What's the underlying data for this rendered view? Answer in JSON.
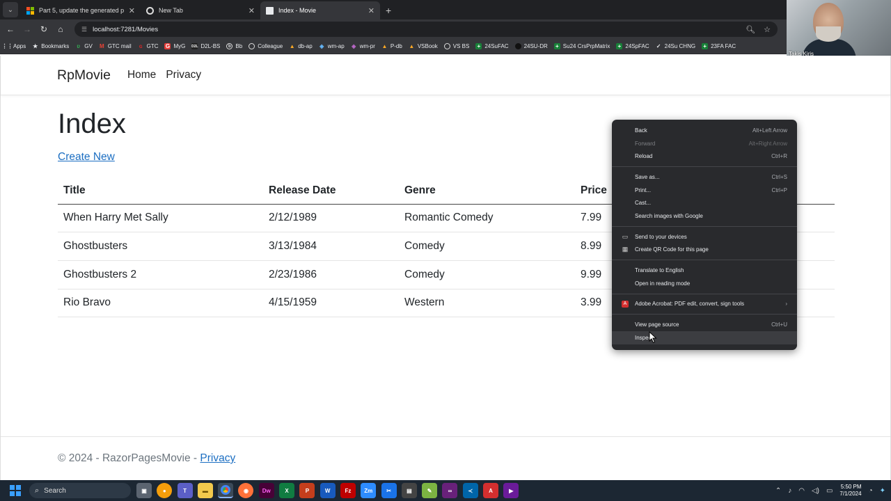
{
  "browser": {
    "tabs": [
      {
        "title": "Part 5, update the generated p",
        "active": false
      },
      {
        "title": "New Tab",
        "active": false
      },
      {
        "title": "Index - Movie",
        "active": true
      }
    ],
    "url": "localhost:7281/Movies",
    "bookmarks": [
      "Apps",
      "Bookmarks",
      "GV",
      "GTC mail",
      "GTC",
      "MyG",
      "D2L-BS",
      "Bb",
      "Colleague",
      "db-ap",
      "wm-ap",
      "wm-pr",
      "P-db",
      "VSBook",
      "VS BS",
      "24SuFAC",
      "24SU-DR",
      "Su24 CrsPrpMatrix",
      "24SpFAC",
      "24Su CHNG",
      "23FA FAC"
    ]
  },
  "webcam": {
    "name": "Takis Kiris"
  },
  "site": {
    "brand": "RpMovie",
    "nav": [
      "Home",
      "Privacy"
    ],
    "heading": "Index",
    "create_link": "Create New",
    "columns": [
      "Title",
      "Release Date",
      "Genre",
      "Price"
    ],
    "rows": [
      [
        "When Harry Met Sally",
        "2/12/1989",
        "Romantic Comedy",
        "7.99"
      ],
      [
        "Ghostbusters",
        "3/13/1984",
        "Comedy",
        "8.99"
      ],
      [
        "Ghostbusters 2",
        "2/23/1986",
        "Comedy",
        "9.99"
      ],
      [
        "Rio Bravo",
        "4/15/1959",
        "Western",
        "3.99"
      ]
    ],
    "footer": {
      "text": "© 2024 - RazorPagesMovie - ",
      "link": "Privacy"
    }
  },
  "context_menu": {
    "groups": [
      [
        {
          "label": "Back",
          "shortcut": "Alt+Left Arrow"
        },
        {
          "label": "Forward",
          "shortcut": "Alt+Right Arrow",
          "disabled": true
        },
        {
          "label": "Reload",
          "shortcut": "Ctrl+R"
        }
      ],
      [
        {
          "label": "Save as...",
          "shortcut": "Ctrl+S"
        },
        {
          "label": "Print...",
          "shortcut": "Ctrl+P"
        },
        {
          "label": "Cast...",
          "shortcut": ""
        },
        {
          "label": "Search images with Google",
          "shortcut": ""
        }
      ],
      [
        {
          "label": "Send to your devices",
          "shortcut": "",
          "icon": "devices-icon"
        },
        {
          "label": "Create QR Code for this page",
          "shortcut": "",
          "icon": "qr-code-icon"
        }
      ],
      [
        {
          "label": "Translate to English",
          "shortcut": ""
        },
        {
          "label": "Open in reading mode",
          "shortcut": ""
        }
      ],
      [
        {
          "label": "Adobe Acrobat: PDF edit, convert, sign tools",
          "shortcut": "",
          "icon": "acrobat-icon",
          "submenu": true
        }
      ],
      [
        {
          "label": "View page source",
          "shortcut": "Ctrl+U"
        },
        {
          "label": "Inspect",
          "shortcut": "",
          "hover": true
        }
      ]
    ]
  },
  "taskbar": {
    "search_label": "Search",
    "time": "5:50 PM",
    "date": "7/1/2024"
  }
}
